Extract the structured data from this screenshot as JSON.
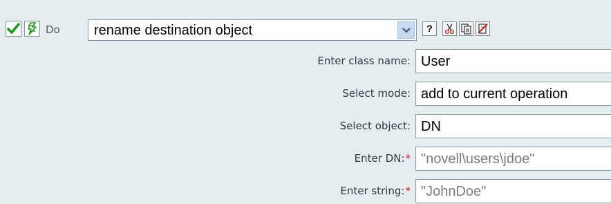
{
  "toolbar": {
    "enable_icon": "checkmark-icon",
    "toggle_icon": "lightning-icon",
    "do_label": "Do",
    "action_value": "rename destination object",
    "help_label": "?",
    "help_icon": "help-icon",
    "cut_icon": "scissors-icon",
    "copy_icon": "copy-icon",
    "delete_icon": "delete-icon"
  },
  "fields": [
    {
      "label": "Enter class name:",
      "required": false,
      "value": "User"
    },
    {
      "label": "Select mode:",
      "required": false,
      "value": "add to current operation"
    },
    {
      "label": "Select object:",
      "required": false,
      "value": "DN"
    },
    {
      "label": "Enter DN:",
      "required": true,
      "required_mark": "*",
      "value": "\"novell\\users\\jdoe\""
    },
    {
      "label": "Enter string:",
      "required": true,
      "required_mark": "*",
      "value": "\"JohnDoe\""
    }
  ],
  "colors": {
    "panel_bg": "#e5edf1",
    "check_green": "#1a9a1a",
    "required_red": "#d02020",
    "muted_text": "#7d7d7d"
  }
}
